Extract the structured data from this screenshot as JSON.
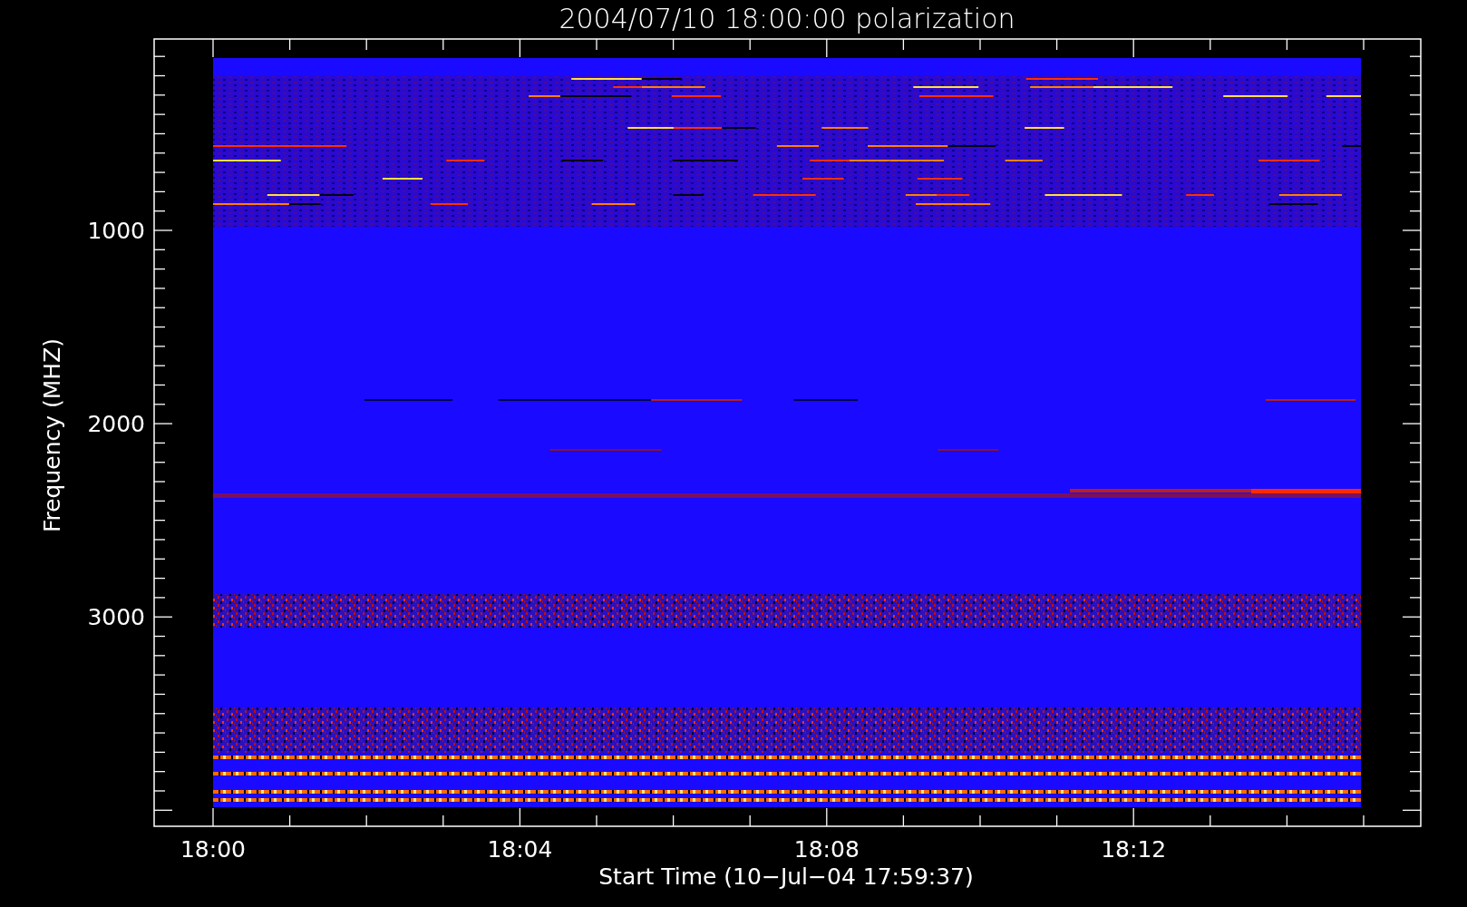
{
  "title": "2004/07/10 18:00:00 polarization",
  "y_axis": {
    "label": "Frequency (MHZ)",
    "ticks": [
      "1000",
      "2000",
      "3000"
    ]
  },
  "x_axis": {
    "label": "Start Time (10−Jul−04 17:59:37)",
    "ticks": [
      "18:00",
      "18:04",
      "18:08",
      "18:12"
    ]
  }
}
